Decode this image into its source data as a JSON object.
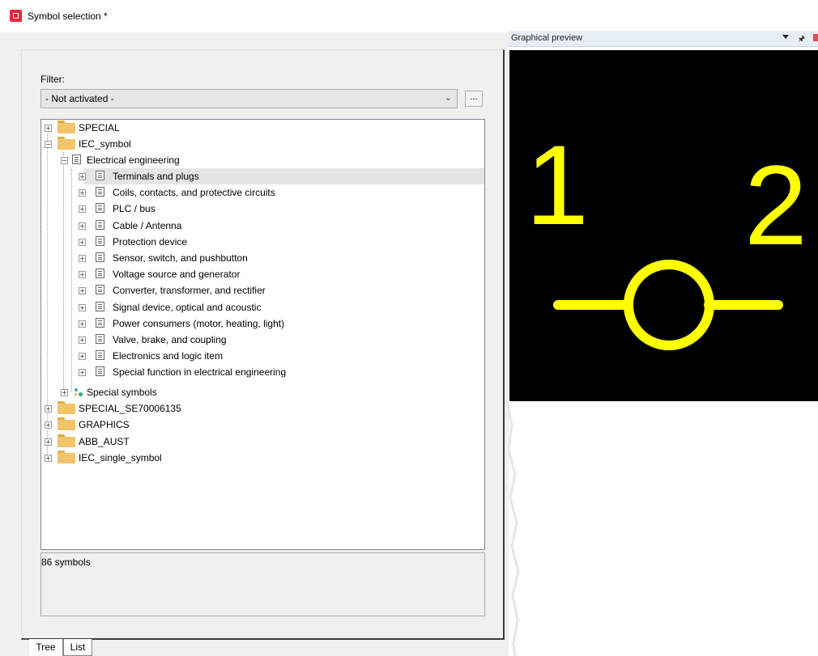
{
  "window": {
    "title": "Symbol selection *"
  },
  "filter": {
    "label": "Filter:",
    "value": "- Not activated -",
    "more_label": "..."
  },
  "tree": {
    "roots": [
      {
        "label": "SPECIAL"
      },
      {
        "label": "IEC_symbol"
      },
      {
        "label": "SPECIAL_SE70006135"
      },
      {
        "label": "GRAPHICS"
      },
      {
        "label": "ABB_AUST"
      },
      {
        "label": "IEC_single_symbol"
      }
    ],
    "electrical_engineering": "Electrical engineering",
    "categories": [
      "Terminals and plugs",
      "Coils, contacts, and protective circuits",
      "PLC / bus",
      "Cable / Antenna",
      "Protection device",
      "Sensor, switch, and pushbutton",
      "Voltage source and generator",
      "Converter, transformer, and rectifier",
      "Signal device, optical and acoustic",
      "Power consumers (motor, heating, light)",
      "Valve, brake, and coupling",
      "Electronics and logic item",
      "Special function in electrical engineering"
    ],
    "special_symbols": "Special symbols",
    "selected_index": 0
  },
  "status": {
    "count": "86 symbols"
  },
  "tabs": {
    "tree": "Tree",
    "list": "List"
  },
  "preview": {
    "title": "Graphical preview",
    "pin1_label": "1",
    "pin2_label": "2",
    "symbol_color": "#ffff00",
    "background_color": "#000000"
  },
  "icons": {
    "app": "app-icon",
    "folder": "folder-icon",
    "category": "category-icon",
    "special": "special-symbols-icon",
    "dropdown": "dropdown-icon",
    "pin": "pin-icon",
    "close": "close-icon"
  }
}
